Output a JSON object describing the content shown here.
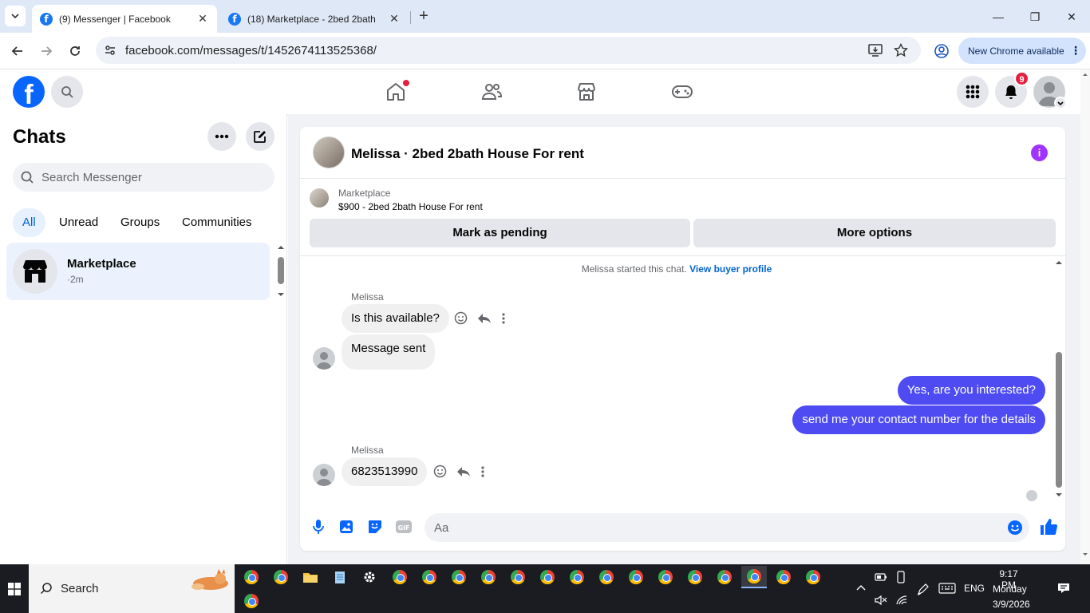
{
  "browser": {
    "tabs": [
      {
        "title": "(9) Messenger | Facebook",
        "active": true
      },
      {
        "title": "(18) Marketplace - 2bed 2bath",
        "active": false
      }
    ],
    "url": "facebook.com/messages/t/1452674113525368/",
    "update_label": "New Chrome available"
  },
  "fb_header": {
    "notification_count": "9"
  },
  "sidebar": {
    "title": "Chats",
    "search_placeholder": "Search Messenger",
    "filters": [
      "All",
      "Unread",
      "Groups",
      "Communities"
    ],
    "chats": [
      {
        "name": "Marketplace",
        "time": "·2m"
      }
    ]
  },
  "conversation": {
    "title": "Melissa · 2bed 2bath House For rent",
    "marketplace_label": "Marketplace",
    "listing": "$900 - 2bed 2bath House For rent",
    "mark_pending_label": "Mark as pending",
    "more_options_label": "More options",
    "system_message": "Melissa started this chat.",
    "system_link": "View buyer profile",
    "messages": [
      {
        "sender": "Melissa",
        "text": "Is this available?",
        "direction": "in"
      },
      {
        "sender": "",
        "text": "Message sent",
        "direction": "in"
      },
      {
        "sender": "",
        "text": "Yes, are you interested?",
        "direction": "out"
      },
      {
        "sender": "",
        "text": "send me your contact number for the details",
        "direction": "out"
      },
      {
        "sender": "Melissa",
        "text": "6823513990",
        "direction": "in"
      }
    ],
    "composer_placeholder": "Aa"
  },
  "colors": {
    "accent": "#0866ff",
    "outgoing_bubble": "#4e4bf2",
    "badge": "#e41e3f",
    "info": "#a033ff"
  },
  "taskbar": {
    "search_label": "Search",
    "language": "ENG",
    "time": "9:17 PM",
    "day": "Monday",
    "date": "3/9/2026"
  }
}
